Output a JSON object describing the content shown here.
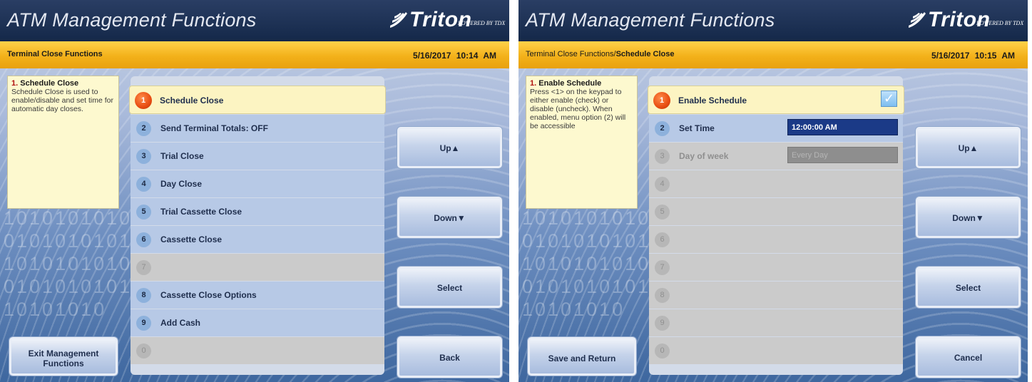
{
  "left": {
    "title": "ATM Management Functions",
    "brand": "Triton",
    "powered": "POWERED BY TDX",
    "breadcrumb": {
      "prefix": "",
      "current": "Terminal Close Functions"
    },
    "datetime": "5/16/2017  10:14 AM",
    "background_binary": "1010101010101010101010101010101010101010101010101010",
    "help": {
      "number": "1.",
      "title": "Schedule Close",
      "text": "Schedule Close is used to enable/disable and set time for automatic day closes."
    },
    "menu": [
      {
        "num": "1",
        "label": "Schedule Close",
        "state": "selected"
      },
      {
        "num": "2",
        "label": "Send Terminal Totals: OFF",
        "state": "active"
      },
      {
        "num": "3",
        "label": "Trial Close",
        "state": "active"
      },
      {
        "num": "4",
        "label": "Day Close",
        "state": "active"
      },
      {
        "num": "5",
        "label": "Trial Cassette Close",
        "state": "active"
      },
      {
        "num": "6",
        "label": "Cassette Close",
        "state": "active"
      },
      {
        "num": "7",
        "label": "",
        "state": "disabled"
      },
      {
        "num": "8",
        "label": "Cassette Close Options",
        "state": "active"
      },
      {
        "num": "9",
        "label": "Add Cash",
        "state": "active"
      },
      {
        "num": "0",
        "label": "",
        "state": "disabled"
      }
    ],
    "buttons": {
      "up": "Up▲",
      "down": "Down▼",
      "select": "Select",
      "back": "Back",
      "exit": "Exit Management Functions"
    }
  },
  "right": {
    "title": "ATM Management Functions",
    "brand": "Triton",
    "powered": "POWERED BY TDX",
    "breadcrumb": {
      "prefix": "Terminal Close Functions/",
      "current": "Schedule Close"
    },
    "datetime": "5/16/2017  10:15 AM",
    "background_binary": "1010101010101010101010101010101010101010101010101010",
    "help": {
      "number": "1.",
      "title": "Enable Schedule",
      "text": "Press <1> on the keypad to either enable (check) or disable (uncheck). When enabled, menu option (2) will be accessible"
    },
    "menu": [
      {
        "num": "1",
        "label": "Enable Schedule",
        "state": "selected",
        "checked": true
      },
      {
        "num": "2",
        "label": "Set Time",
        "state": "active",
        "value": "12:00:00 AM"
      },
      {
        "num": "3",
        "label": "Day of week",
        "state": "disabled",
        "value": "Every Day"
      },
      {
        "num": "4",
        "label": "",
        "state": "disabled"
      },
      {
        "num": "5",
        "label": "",
        "state": "disabled"
      },
      {
        "num": "6",
        "label": "",
        "state": "disabled"
      },
      {
        "num": "7",
        "label": "",
        "state": "disabled"
      },
      {
        "num": "8",
        "label": "",
        "state": "disabled"
      },
      {
        "num": "9",
        "label": "",
        "state": "disabled"
      },
      {
        "num": "0",
        "label": "",
        "state": "disabled"
      }
    ],
    "buttons": {
      "up": "Up▲",
      "down": "Down▼",
      "select": "Select",
      "cancel": "Cancel",
      "save": "Save and Return"
    }
  },
  "colors": {
    "titlebar": "#1b2f55",
    "subbar": "#f5b520",
    "selected_row": "#fcf4c2",
    "active_row": "#b7c9e6",
    "disabled_row": "#cbcbcb",
    "field_on": "#1b3a87"
  }
}
